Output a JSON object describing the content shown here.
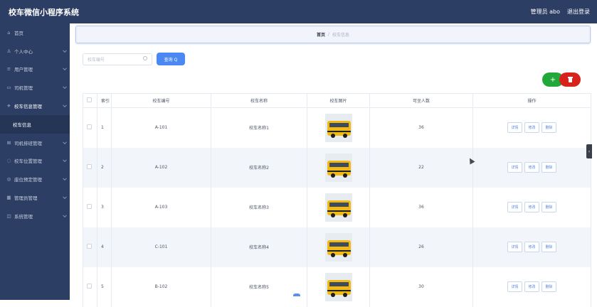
{
  "header": {
    "title": "校车微信小程序系统",
    "user": "管理员 abo",
    "logout": "退出登录"
  },
  "sidebar": {
    "items": [
      {
        "label": "首页",
        "icon": "home-icon",
        "glyph": "⌂",
        "chev": false
      },
      {
        "label": "个人中心",
        "icon": "user-icon",
        "glyph": "♙",
        "chev": true
      },
      {
        "label": "用户管理",
        "icon": "bar-chart-icon",
        "glyph": "≡",
        "chev": true
      },
      {
        "label": "司机管理",
        "icon": "card-icon",
        "glyph": "▭",
        "chev": true
      },
      {
        "label": "校车信息管理",
        "icon": "pin-icon",
        "glyph": "✈",
        "chev": true,
        "active": true
      },
      {
        "label": "校车信息",
        "sub": true
      },
      {
        "label": "司机排班管理",
        "icon": "table-icon",
        "glyph": "⊞",
        "chev": true
      },
      {
        "label": "校车位置管理",
        "icon": "location-icon",
        "glyph": "◌",
        "chev": true
      },
      {
        "label": "座位预定管理",
        "icon": "seat-icon",
        "glyph": "◎",
        "chev": true
      },
      {
        "label": "管理员管理",
        "icon": "grid-icon",
        "glyph": "▦",
        "chev": true
      },
      {
        "label": "系统管理",
        "icon": "system-icon",
        "glyph": "◫",
        "chev": true
      }
    ]
  },
  "breadcrumb": {
    "home": "首页",
    "sep": "/",
    "current": "校车信息"
  },
  "search": {
    "placeholder": "校车编号",
    "button": "查询 Q"
  },
  "actions": {
    "add": "+",
    "delete_icon": "trash-icon"
  },
  "table": {
    "headers": [
      "",
      "索引",
      "校车编号",
      "校车名称",
      "校车图片",
      "可坐人数",
      "操作"
    ],
    "ops": [
      "详情",
      "修改",
      "删除"
    ],
    "rows": [
      {
        "index": "1",
        "code": "A-101",
        "name": "校车名称1",
        "seats": "36"
      },
      {
        "index": "2",
        "code": "A-102",
        "name": "校车名称2",
        "seats": "22"
      },
      {
        "index": "3",
        "code": "A-103",
        "name": "校车名称3",
        "seats": "36"
      },
      {
        "index": "4",
        "code": "C-101",
        "name": "校车名称4",
        "seats": "26"
      },
      {
        "index": "5",
        "code": "B-102",
        "name": "校车名称5",
        "seats": "30"
      }
    ]
  },
  "colors": {
    "sidebar": "#2c3e63",
    "primary": "#4b88f3",
    "add": "#22a73a",
    "delete": "#d8231c"
  }
}
